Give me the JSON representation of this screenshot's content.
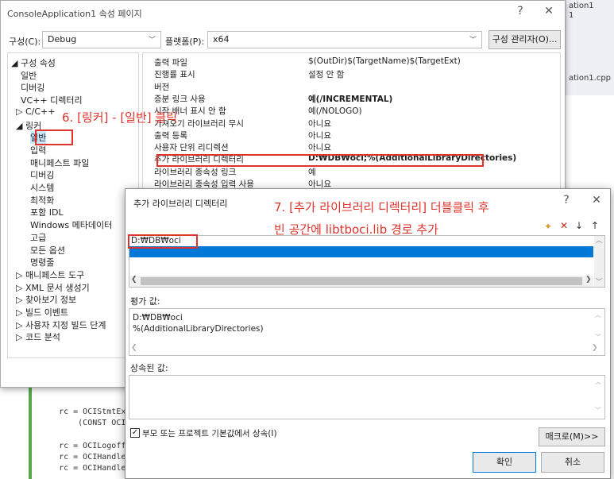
{
  "background": {
    "right_header": "ation1.cpp",
    "right_top_1": "ation1",
    "right_top_2": "1",
    "code_lines": [
      "    rc = OCIStmtExecut",
      "        (CONST OCISnap",
      "",
      "    rc = OCILogoff(p_s",
      "    rc = OCIHandleFree",
      "    rc = OCIHandleFree"
    ]
  },
  "property_window": {
    "title": "ConsoleApplication1 속성 페이지",
    "help_glyph": "?",
    "close_glyph": "✕",
    "config_label": "구성(C):",
    "config_value": "Debug",
    "platform_label": "플랫폼(P):",
    "platform_value": "x64",
    "config_manager_button": "구성 관리자(O)...",
    "tree": [
      {
        "label": "◢ 구성 속성",
        "indent": 0
      },
      {
        "label": "일반",
        "indent": 1
      },
      {
        "label": "디버깅",
        "indent": 1
      },
      {
        "label": "VC++ 디렉터리",
        "indent": 1
      },
      {
        "label": "▷ C/C++",
        "indent": 0.5
      },
      {
        "label": "◢ 링커",
        "indent": 0.5
      },
      {
        "label": "일반",
        "indent": 2,
        "selected": true
      },
      {
        "label": "입력",
        "indent": 2
      },
      {
        "label": "매니페스트 파일",
        "indent": 2
      },
      {
        "label": "디버깅",
        "indent": 2
      },
      {
        "label": "시스템",
        "indent": 2
      },
      {
        "label": "최적화",
        "indent": 2
      },
      {
        "label": "포함 IDL",
        "indent": 2
      },
      {
        "label": "Windows 메타데이터",
        "indent": 2
      },
      {
        "label": "고급",
        "indent": 2
      },
      {
        "label": "모든 옵션",
        "indent": 2
      },
      {
        "label": "명령줄",
        "indent": 2
      },
      {
        "label": "▷ 매니페스트 도구",
        "indent": 0.5
      },
      {
        "label": "▷ XML 문서 생성기",
        "indent": 0.5
      },
      {
        "label": "▷ 찾아보기 정보",
        "indent": 0.5
      },
      {
        "label": "▷ 빌드 이벤트",
        "indent": 0.5
      },
      {
        "label": "▷ 사용자 지정 빌드 단계",
        "indent": 0.5
      },
      {
        "label": "▷ 코드 분석",
        "indent": 0.5
      }
    ],
    "grid": [
      {
        "name": "출력 파일",
        "value": "$(OutDir)$(TargetName)$(TargetExt)",
        "bold": false
      },
      {
        "name": "진행률 표시",
        "value": "설정 안 함",
        "bold": false
      },
      {
        "name": "버전",
        "value": "",
        "bold": false
      },
      {
        "name": "증분 링크 사용",
        "value": "예(/INCREMENTAL)",
        "bold": true
      },
      {
        "name": "시작 배너 표시 안 함",
        "value": "예(/NOLOGO)",
        "bold": false
      },
      {
        "name": "가져오기 라이브러리 무시",
        "value": "아니요",
        "bold": false
      },
      {
        "name": "출력 등록",
        "value": "아니요",
        "bold": false
      },
      {
        "name": "사용자 단위 리디렉션",
        "value": "아니요",
        "bold": false
      },
      {
        "name": "추가 라이브러리 디렉터리",
        "value": "D:₩DB₩oci;%(AdditionalLibraryDirectories)",
        "bold": true
      },
      {
        "name": "라이브러리 종속성 링크",
        "value": "예",
        "bold": false
      },
      {
        "name": "라이브러리 종속성 입력 사용",
        "value": "아니요",
        "bold": false
      }
    ],
    "annotation_6": "6. [링커] - [일반] 클릭"
  },
  "dialog": {
    "title": "추가 라이브러리 디렉터리",
    "help_glyph": "?",
    "close_glyph": "✕",
    "annotation_7_line1": "7. [추가 라이브러리 디렉터리] 더블클릭 후",
    "annotation_7_line2": "빈 공간에 libtboci.lib 경로 추가",
    "list_items": [
      "D:₩DB₩oci",
      ""
    ],
    "evaluated_label": "평가 값:",
    "evaluated_lines": [
      "D:₩DB₩oci",
      "%(AdditionalLibraryDirectories)"
    ],
    "inherited_label": "상속된 값:",
    "inherit_checkbox_label": "부모 또는 프로젝트 기본값에서 상속(I)",
    "inherit_checked": true,
    "macro_button": "매크로(M)>>",
    "ok_button": "확인",
    "cancel_button": "취소",
    "colors": {
      "selection": "#0078d7",
      "annotation": "#e0332c"
    }
  }
}
